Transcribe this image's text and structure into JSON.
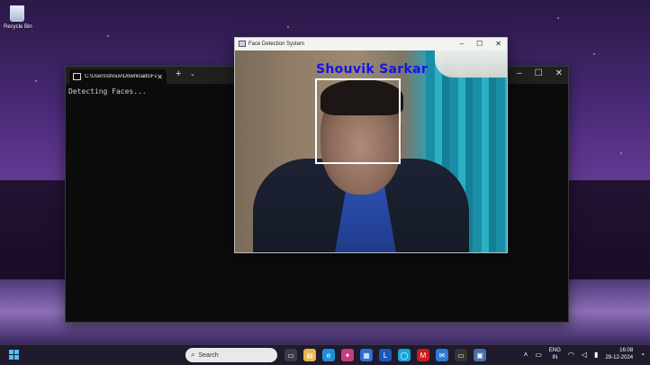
{
  "desktop": {
    "recycle_bin_label": "Recycle Bin"
  },
  "terminal": {
    "tab_title": "C:\\Users\\shouv\\Downloads\\Fa",
    "output": "Detecting Faces..."
  },
  "face_window": {
    "title": "Face Detection System",
    "detected_label": "Shouvik Sarkar"
  },
  "taskbar": {
    "search_placeholder": "Search",
    "language": "ENG",
    "region": "IN",
    "time": "16:08",
    "date": "29-12-2024",
    "colors": {
      "accent": "#4cc2ff",
      "label_color": "#1414e6",
      "box_color": "#ffffff"
    }
  }
}
